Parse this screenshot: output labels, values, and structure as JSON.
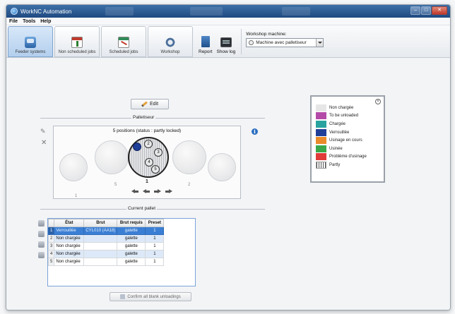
{
  "window": {
    "title": "WorkNC Automation",
    "minimize": "–",
    "maximize": "□",
    "close": "✕"
  },
  "menu": [
    "File",
    "Tools",
    "Help"
  ],
  "toolbar": {
    "tabs": [
      {
        "label": "Feeder systems",
        "icon": "feeder-icon",
        "active": true
      },
      {
        "label": "Non scheduled jobs",
        "icon": "job-icon",
        "active": false
      },
      {
        "label": "Scheduled jobs",
        "icon": "scheduled-icon",
        "active": false
      },
      {
        "label": "Workshop",
        "icon": "workshop-icon",
        "active": false
      }
    ],
    "report_label": "Report",
    "show_log_label": "Show log",
    "machine_label": "Workshop machine:",
    "machine_value": "Machine avec palletiseur"
  },
  "edit_label": "Edit",
  "palletiseur": {
    "title": "Palletiseur",
    "status": "5 positions (status : partly locked)",
    "pallet_number": "1",
    "ghost_numbers": [
      "5",
      "2",
      "1"
    ],
    "positions": [
      {
        "num": "1",
        "state": "locked",
        "color": "#1f3f98"
      },
      {
        "num": "2",
        "state": "empty",
        "color": "#e8e9ea"
      },
      {
        "num": "3",
        "state": "empty",
        "color": "#e8e9ea"
      },
      {
        "num": "4",
        "state": "empty",
        "color": "#e8e9ea"
      },
      {
        "num": "5",
        "state": "empty",
        "color": "#e8e9ea"
      }
    ]
  },
  "current_pallet": {
    "title": "Current pallet",
    "columns": [
      "État",
      "Brut",
      "Brut requis",
      "Preset"
    ],
    "rows": [
      {
        "n": "1",
        "etat": "Verrouillée",
        "brut": "CYL010 (AA18)",
        "brut_requis": "galette",
        "preset": "1"
      },
      {
        "n": "2",
        "etat": "Non chargée",
        "brut": "",
        "brut_requis": "galette",
        "preset": "1"
      },
      {
        "n": "3",
        "etat": "Non chargée",
        "brut": "",
        "brut_requis": "galette",
        "preset": "1"
      },
      {
        "n": "4",
        "etat": "Non chargée",
        "brut": "",
        "brut_requis": "galette",
        "preset": "1"
      },
      {
        "n": "5",
        "etat": "Non chargée",
        "brut": "",
        "brut_requis": "galette",
        "preset": "1"
      }
    ],
    "confirm_label": "Confirm all blank unloadings"
  },
  "legend": {
    "items": [
      {
        "label": "Non chargée",
        "color": "#e6e6e6"
      },
      {
        "label": "To be unloaded",
        "color": "#b44aa8"
      },
      {
        "label": "Chargée",
        "color": "#2aa3a0"
      },
      {
        "label": "Verrouillée",
        "color": "#1f3f98"
      },
      {
        "label": "Usinage en cours",
        "color": "#e98b2a"
      },
      {
        "label": "Usinée",
        "color": "#3aa84a"
      },
      {
        "label": "Problème d'usinage",
        "color": "#e03a3a"
      },
      {
        "label": "Partly",
        "color": "stripes"
      }
    ]
  }
}
